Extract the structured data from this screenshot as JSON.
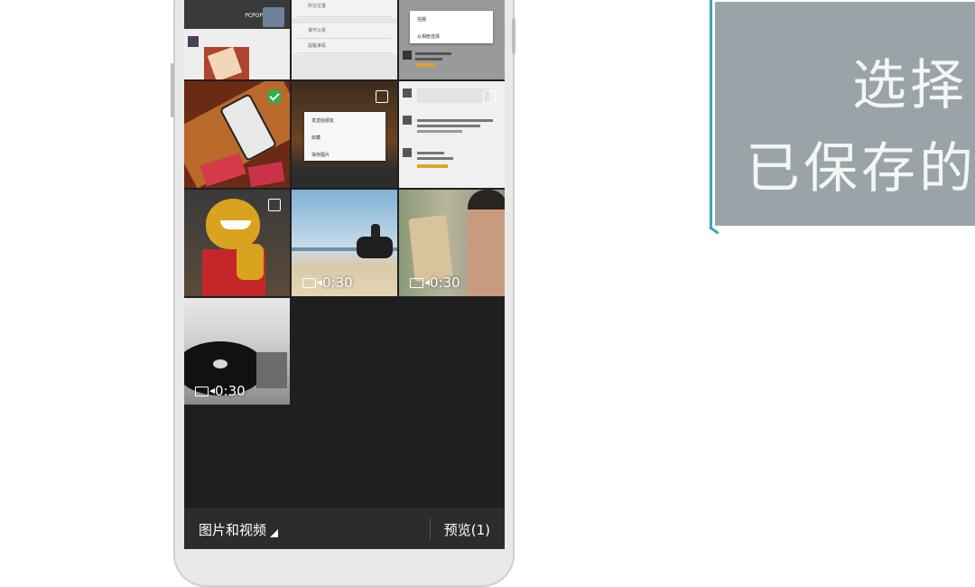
{
  "gallery": {
    "tiles": [
      {
        "kind": "screenshot-profile",
        "label": "PCPOP"
      },
      {
        "kind": "screenshot-settings",
        "items": [
          "所在位置",
          "谁可以看",
          "提醒谁看"
        ]
      },
      {
        "kind": "screenshot-chat-menu",
        "items": [
          "拍摄",
          "从相册选择"
        ]
      },
      {
        "kind": "photo",
        "selected": true
      },
      {
        "kind": "screenshot-longpress-menu",
        "items": [
          "发送给朋友",
          "收藏",
          "保存图片"
        ],
        "selected": false
      },
      {
        "kind": "screenshot-chat",
        "selected": false
      },
      {
        "kind": "photo",
        "selected": false
      },
      {
        "kind": "video",
        "duration": "0:30"
      },
      {
        "kind": "video",
        "duration": "0:30"
      },
      {
        "kind": "video",
        "duration": "0:30"
      }
    ]
  },
  "bottom_bar": {
    "album_label": "图片和视频",
    "preview_label": "预览(1)"
  },
  "caption": {
    "line1": "选择",
    "line2": "已保存的"
  },
  "colors": {
    "accent": "#3ea6b3",
    "selected_check": "#28b24a",
    "caption_bg": "#9aa4a8"
  }
}
